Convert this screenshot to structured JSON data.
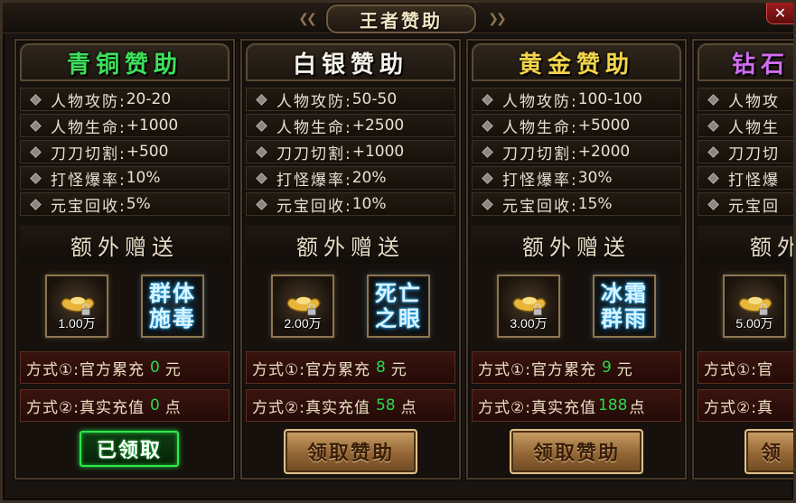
{
  "window": {
    "title": "王者赞助",
    "close_symbol": "✕"
  },
  "stat_labels": [
    "人物攻防:",
    "人物生命:",
    "刀刀切割:",
    "打怪爆率:",
    "元宝回收:"
  ],
  "extra_label": "额外赠送",
  "tiers": [
    {
      "name": "青铜赞助",
      "name_color": "#3ee05a",
      "stats": [
        "20-20",
        "+1000",
        "+500",
        "10%",
        "5%"
      ],
      "ingot_amount": "1.00万",
      "skill_lines": [
        "群体",
        "施毒"
      ],
      "method1": {
        "label": "方式①:官方累充",
        "value": "0",
        "unit": "元"
      },
      "method2": {
        "label": "方式②:真实充值",
        "value": "0",
        "unit": "点"
      },
      "button": {
        "label": "已领取",
        "state": "claimed"
      }
    },
    {
      "name": "白银赞助",
      "name_color": "#f4f1ea",
      "stats": [
        "50-50",
        "+2500",
        "+1000",
        "20%",
        "10%"
      ],
      "ingot_amount": "2.00万",
      "skill_lines": [
        "死亡",
        "之眼"
      ],
      "method1": {
        "label": "方式①:官方累充",
        "value": "8",
        "unit": "元"
      },
      "method2": {
        "label": "方式②:真实充值",
        "value": "58",
        "unit": "点"
      },
      "button": {
        "label": "领取赞助",
        "state": "available"
      }
    },
    {
      "name": "黄金赞助",
      "name_color": "#f3d54a",
      "stats": [
        "100-100",
        "+5000",
        "+2000",
        "30%",
        "15%"
      ],
      "ingot_amount": "3.00万",
      "skill_lines": [
        "冰霜",
        "群雨"
      ],
      "method1": {
        "label": "方式①:官方累充",
        "value": "9",
        "unit": "元"
      },
      "method2": {
        "label": "方式②:真实充值",
        "value": "188",
        "unit": "点"
      },
      "button": {
        "label": "领取赞助",
        "state": "available"
      }
    },
    {
      "name": "钻石",
      "name_color": "#d16cf0",
      "stats_partial": [
        "人物攻",
        "人物生",
        "刀刀切",
        "打怪爆",
        "元宝回"
      ],
      "ingot_amount": "5.00万",
      "method1_partial": "方式①:官",
      "method2_partial": "方式②:真",
      "button_partial": "领"
    }
  ]
}
